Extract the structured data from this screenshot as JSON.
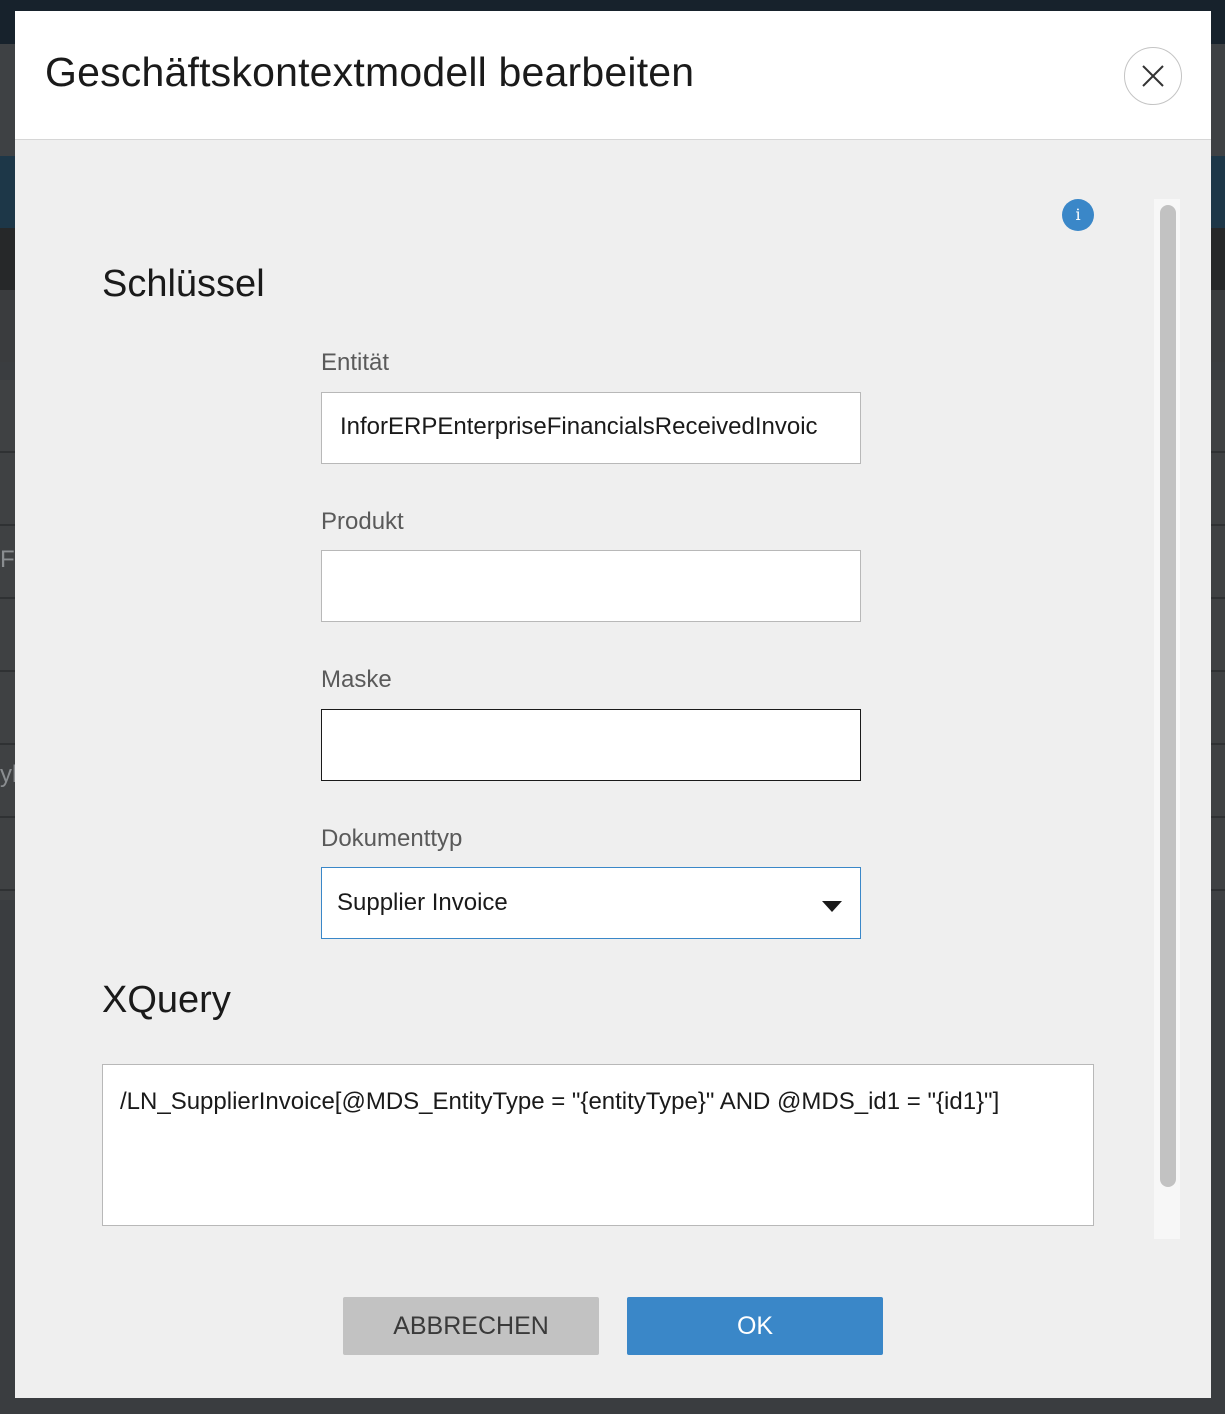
{
  "background": {
    "edge_texts": [
      "Fi",
      "ylt"
    ]
  },
  "dialog": {
    "title": "Geschäftskontextmodell bearbeiten",
    "close_icon": "close-icon",
    "info_icon": "info-icon",
    "info_glyph": "i"
  },
  "keys_section": {
    "title": "Schlüssel",
    "fields": {
      "entity": {
        "label": "Entität",
        "value": "InforERPEnterpriseFinancialsReceivedInvoic"
      },
      "product": {
        "label": "Produkt",
        "value": ""
      },
      "mask": {
        "label": "Maske",
        "value": ""
      },
      "doctype": {
        "label": "Dokumenttyp",
        "value": "Supplier Invoice"
      }
    }
  },
  "xquery_section": {
    "title": "XQuery",
    "value": "/LN_SupplierInvoice[@MDS_EntityType = \"{entityType}\" AND @MDS_id1 = \"{id1}\"]"
  },
  "footer": {
    "cancel_label": "ABBRECHEN",
    "ok_label": "OK"
  },
  "colors": {
    "accent": "#3a87c8",
    "dialog_bg": "#efefef",
    "cancel_bg": "#c2c2c2"
  }
}
